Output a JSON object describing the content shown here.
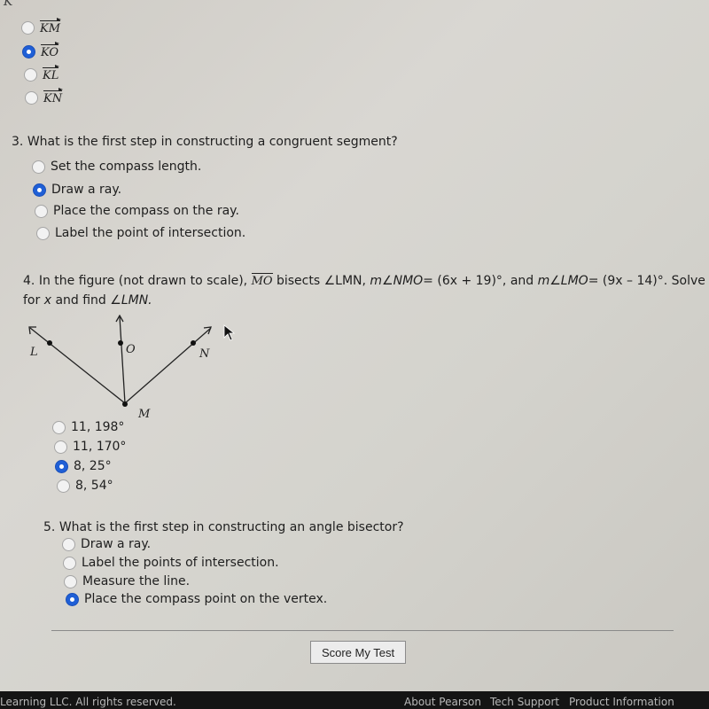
{
  "question2_partial": {
    "vertex_label": "K",
    "options": [
      {
        "label": "KM",
        "selected": false
      },
      {
        "label": "KO",
        "selected": true
      },
      {
        "label": "KL",
        "selected": false
      },
      {
        "label": "KN",
        "selected": false
      }
    ]
  },
  "question3": {
    "number": "3.",
    "text": "What is the first step in constructing a congruent segment?",
    "options": [
      {
        "label": "Set the compass length.",
        "selected": false
      },
      {
        "label": "Draw a ray.",
        "selected": true
      },
      {
        "label": "Place the compass on the ray.",
        "selected": false
      },
      {
        "label": "Label the point of intersection.",
        "selected": false
      }
    ]
  },
  "question4": {
    "number": "4.",
    "text_a": "In the figure (not drawn to scale),",
    "segment": "MO",
    "text_b": "bisects ∠LMN,",
    "m1": "m∠NMO",
    "eq1": "= (6x + 19)°, and",
    "m2": "m∠LMO",
    "eq2": "= (9x – 14)°. Solve",
    "line2_a": "for",
    "line2_var": "x",
    "line2_b": "and find",
    "line2_angle": "∠LMN.",
    "figure": {
      "labels": {
        "L": "L",
        "O": "O",
        "N": "N",
        "M": "M"
      }
    },
    "options": [
      {
        "label": "11, 198°",
        "selected": false
      },
      {
        "label": "11, 170°",
        "selected": false
      },
      {
        "label": "8, 25°",
        "selected": true
      },
      {
        "label": "8, 54°",
        "selected": false
      }
    ]
  },
  "question5": {
    "number": "5.",
    "text": "What is the first step in constructing an angle bisector?",
    "options": [
      {
        "label": "Draw a ray.",
        "selected": false
      },
      {
        "label": "Label the points of intersection.",
        "selected": false
      },
      {
        "label": "Measure the line.",
        "selected": false
      },
      {
        "label": "Place the compass point on the vertex.",
        "selected": true
      }
    ]
  },
  "actions": {
    "score_button": "Score My Test"
  },
  "footer": {
    "copyright": "Learning LLC. All rights reserved.",
    "links": [
      "About Pearson",
      "Tech Support",
      "Product Information"
    ]
  }
}
